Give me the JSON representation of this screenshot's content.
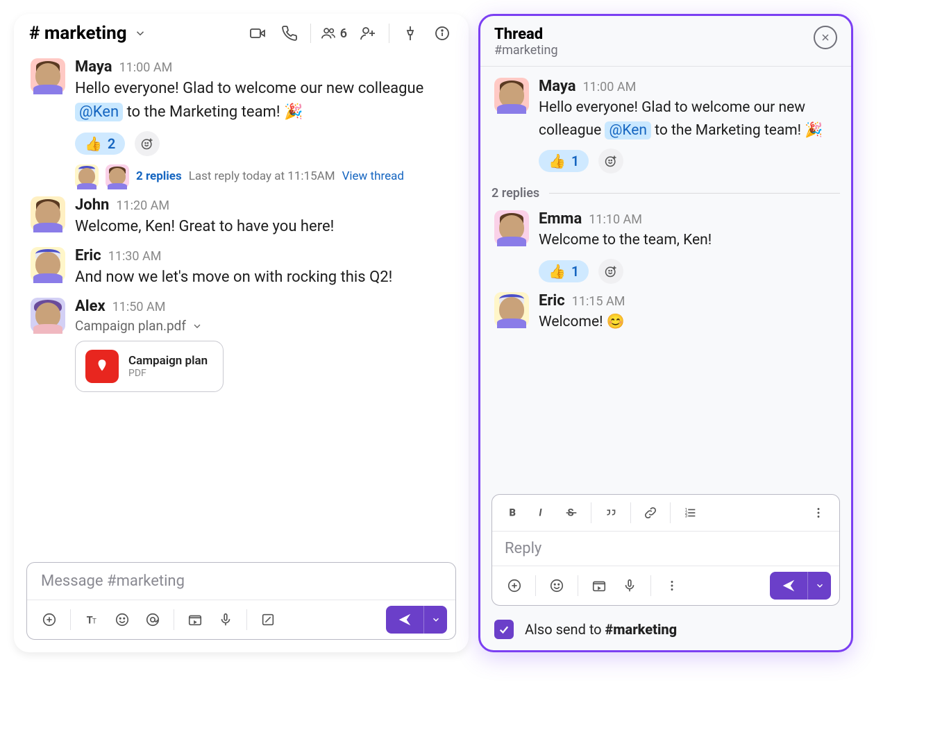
{
  "channel": {
    "hash": "#",
    "name": "marketing",
    "title": "# marketing",
    "member_count": "6"
  },
  "messages": [
    {
      "author": "Maya",
      "time": "11:00 AM",
      "text_before": "Hello everyone! Glad to welcome our new colleague ",
      "mention": "@Ken",
      "text_after": " to the Marketing team! 🎉",
      "reaction_emoji": "👍",
      "reaction_count": "2",
      "replies_count": "2 replies",
      "replies_meta": "Last reply today at 11:15AM",
      "view_thread": "View thread"
    },
    {
      "author": "John",
      "time": "11:20 AM",
      "text": "Welcome, Ken! Great to have you here!"
    },
    {
      "author": "Eric",
      "time": "11:30 AM",
      "text": "And now we let's move on with rocking this Q2!"
    },
    {
      "author": "Alex",
      "time": "11:50 AM",
      "attachment_label": "Campaign plan.pdf",
      "file_name": "Campaign plan",
      "file_type": "PDF"
    }
  ],
  "composer": {
    "placeholder": "Message #marketing"
  },
  "thread": {
    "title": "Thread",
    "subtitle": "#marketing",
    "root": {
      "author": "Maya",
      "time": "11:00 AM",
      "text_before": "Hello everyone! Glad to welcome our new colleague ",
      "mention": "@Ken",
      "text_after": " to the Marketing team! 🎉",
      "reaction_emoji": "👍",
      "reaction_count": "1"
    },
    "replies_label": "2 replies",
    "replies": [
      {
        "author": "Emma",
        "time": "11:10 AM",
        "text": "Welcome to the team, Ken!",
        "reaction_emoji": "👍",
        "reaction_count": "1"
      },
      {
        "author": "Eric",
        "time": "11:15 AM",
        "text": "Welcome! 😊"
      }
    ],
    "composer": {
      "placeholder": "Reply"
    },
    "also_send_prefix": "Also send to ",
    "also_send_channel": "#marketing",
    "also_send_checked": true
  }
}
